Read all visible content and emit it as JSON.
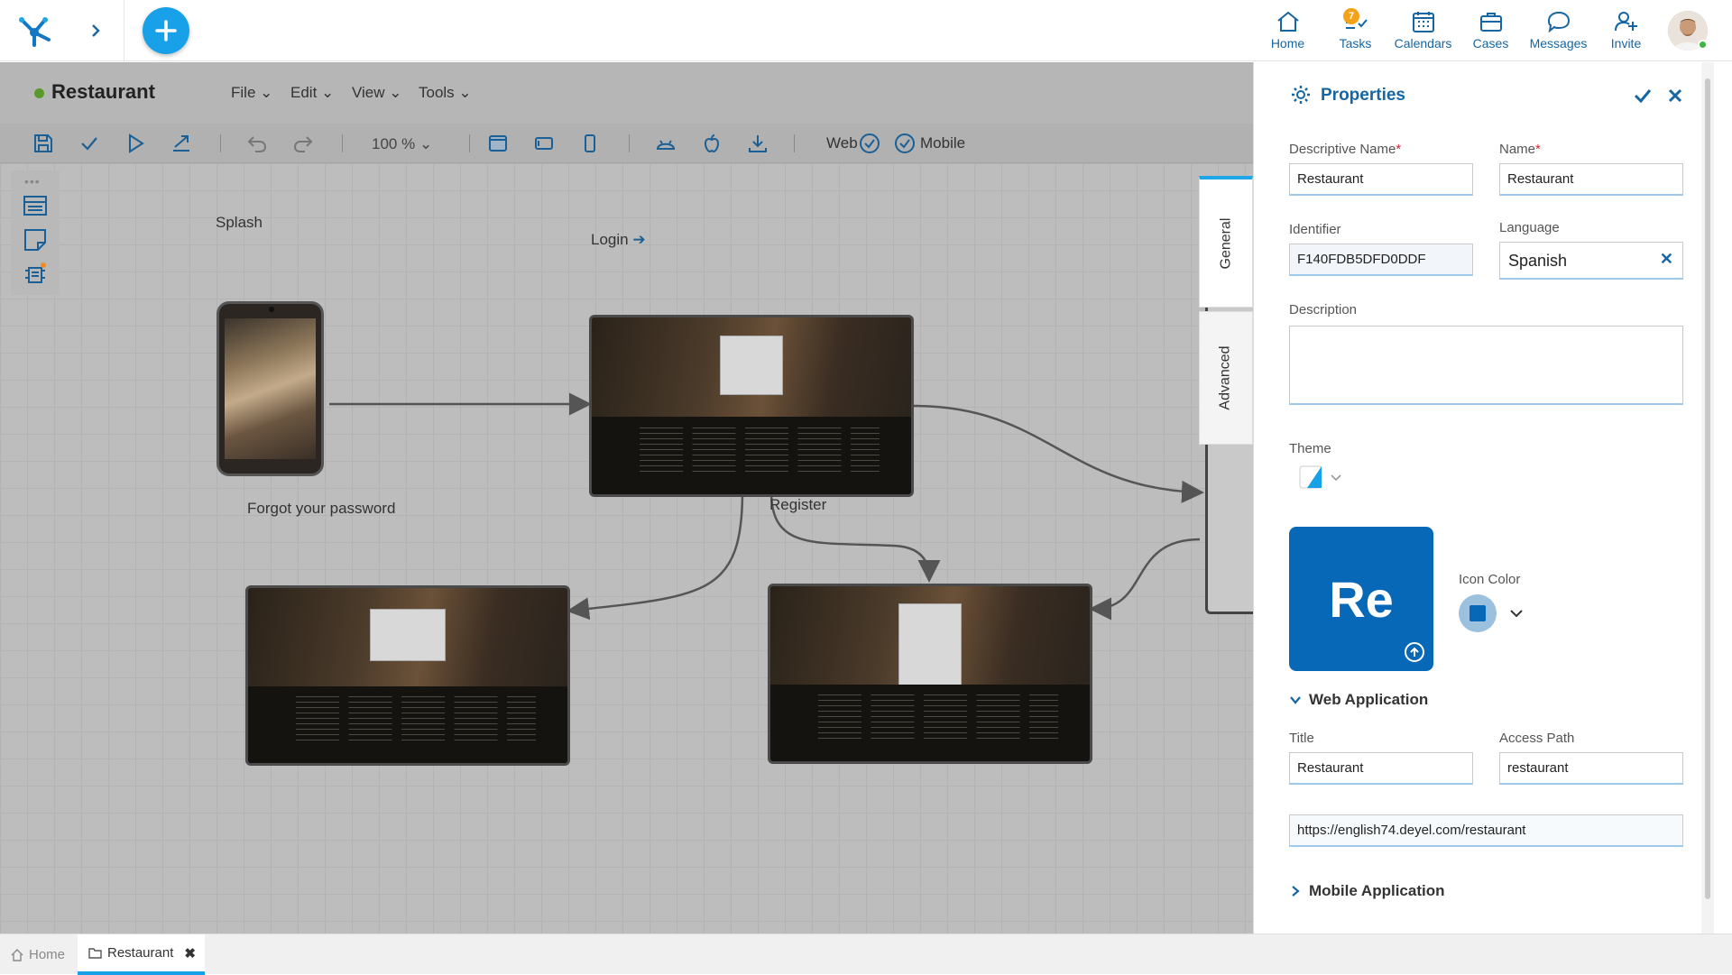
{
  "topnav": {
    "items": [
      {
        "label": "Home",
        "icon": "home-icon"
      },
      {
        "label": "Tasks",
        "icon": "tasks-icon",
        "badge": "7"
      },
      {
        "label": "Calendars",
        "icon": "calendar-icon"
      },
      {
        "label": "Cases",
        "icon": "briefcase-icon"
      },
      {
        "label": "Messages",
        "icon": "chat-icon"
      },
      {
        "label": "Invite",
        "icon": "add-user-icon"
      }
    ]
  },
  "editor": {
    "title": "Restaurant",
    "status_color": "#5b9a2a",
    "menus": [
      "File",
      "Edit",
      "View",
      "Tools"
    ],
    "zoom": "100 %",
    "web_label": "Web",
    "mobile_label": "Mobile"
  },
  "diagram": {
    "nodes": [
      {
        "label": "Splash"
      },
      {
        "label": "Login"
      },
      {
        "label": "Forgot your password"
      },
      {
        "label": "Register"
      }
    ]
  },
  "side_tabs": [
    "General",
    "Advanced"
  ],
  "properties": {
    "title": "Properties",
    "descriptive_name_label": "Descriptive Name",
    "descriptive_name_value": "Restaurant",
    "name_label": "Name",
    "name_value": "Restaurant",
    "identifier_label": "Identifier",
    "identifier_value": "F140FDB5DFD0DDF",
    "language_label": "Language",
    "language_value": "Spanish",
    "description_label": "Description",
    "description_value": "",
    "theme_label": "Theme",
    "icon_text": "Re",
    "icon_color_label": "Icon Color",
    "icon_color": "#0868b8",
    "web_section": "Web Application",
    "title_label": "Title",
    "title_value": "Restaurant",
    "access_path_label": "Access Path",
    "access_path_value": "restaurant",
    "url_value": "https://english74.deyel.com/restaurant",
    "mobile_section": "Mobile Application"
  },
  "bottom_tabs": [
    {
      "label": "Home"
    },
    {
      "label": "Restaurant"
    }
  ],
  "colors": {
    "accent": "#1666a3",
    "add_button": "#18a0e8"
  }
}
